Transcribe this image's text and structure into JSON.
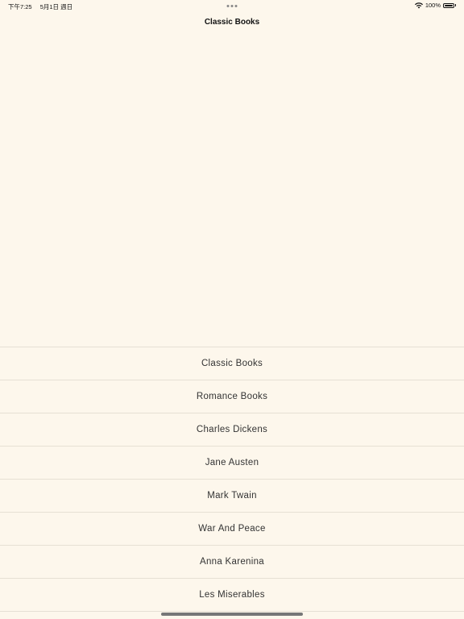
{
  "status_bar": {
    "time": "下午7:25",
    "date": "5月1日 週日",
    "battery": "100%",
    "wifi_icon": "wifi-icon",
    "battery_icon": "battery-icon",
    "battery_level": 1.0
  },
  "nav": {
    "title": "Classic Books",
    "more_icon": "ellipsis-icon"
  },
  "list": {
    "items": [
      {
        "label": "Classic Books"
      },
      {
        "label": "Romance Books"
      },
      {
        "label": "Charles Dickens"
      },
      {
        "label": "Jane Austen"
      },
      {
        "label": "Mark Twain"
      },
      {
        "label": "War And Peace"
      },
      {
        "label": "Anna Karenina"
      },
      {
        "label": "Les Miserables"
      }
    ]
  },
  "colors": {
    "background": "#fdf7ec",
    "separator": "#e6e0d4",
    "text": "#333333"
  }
}
